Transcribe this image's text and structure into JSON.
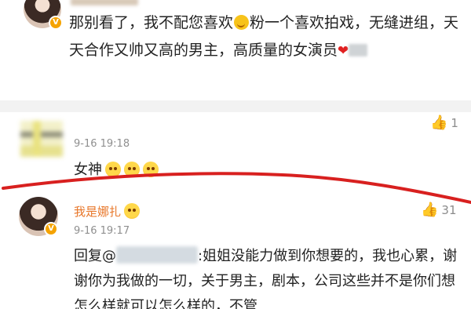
{
  "post": {
    "text_a": "那别看了，我不配您喜欢",
    "text_b": "粉一个喜欢拍戏，无缝进组，天天合作又帅又高的男主，高质量的女演员",
    "heart": "❤"
  },
  "comments": [
    {
      "time": "9-16 19:18",
      "likes": "1",
      "text": "女神",
      "emoji_count": 3
    },
    {
      "author": "我是娜扎",
      "time": "9-16 19:17",
      "likes": "31",
      "reply_prefix": "回复@",
      "reply_body": ":姐姐没能力做到你想要的，我也心累，谢谢你为我做的一切，关于男主，剧本，公司这些并不是你们想怎么样就可以怎么样的，不管"
    }
  ],
  "icons": {
    "thumb": "👍",
    "verified": "V"
  },
  "colors": {
    "name": "#e8772a",
    "mention": "#3b6fb4",
    "annotation_line": "#d8201f",
    "divider": "#f2f2f2"
  }
}
